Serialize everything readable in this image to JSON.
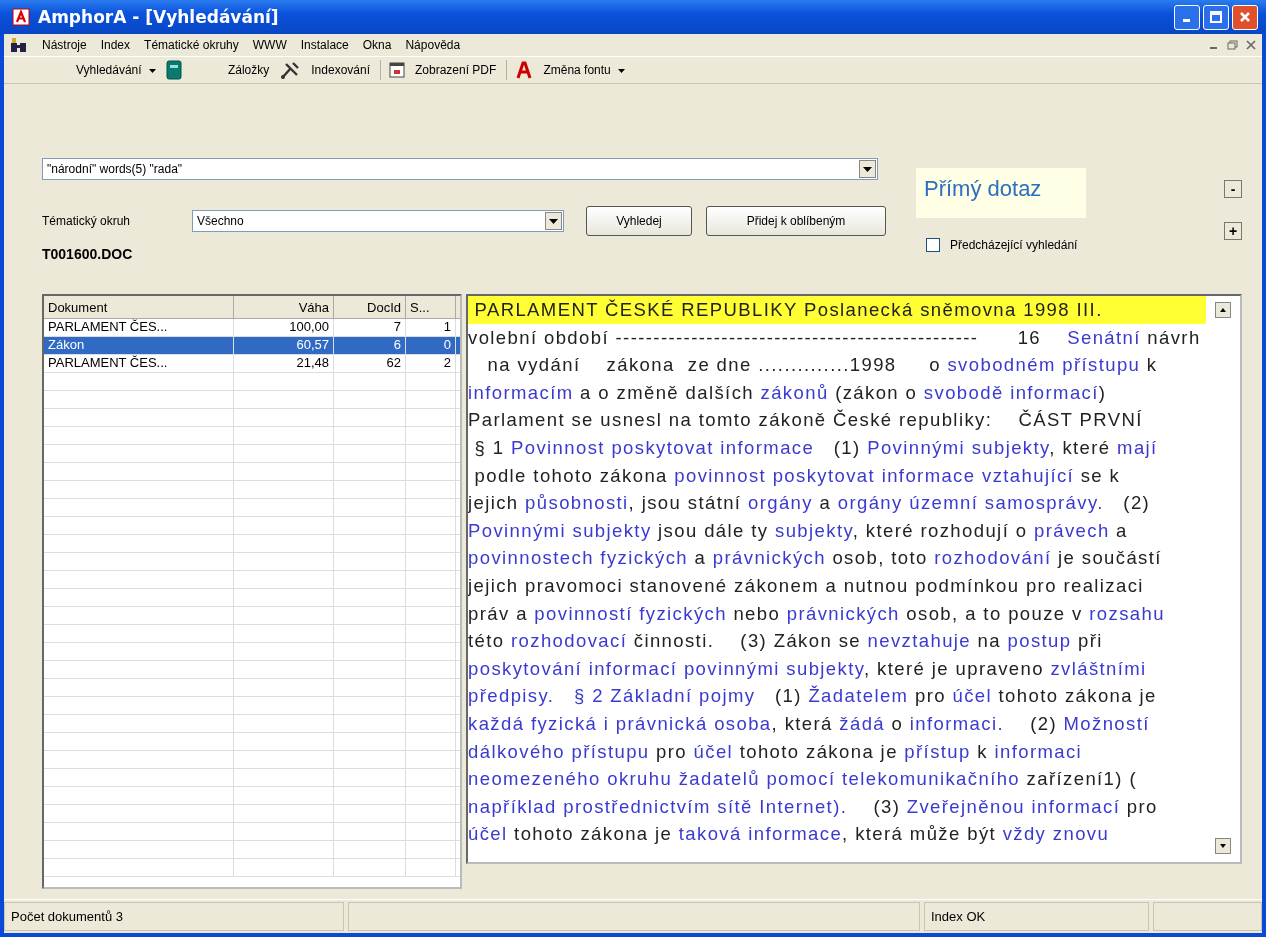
{
  "window": {
    "title": "AmphorA - [Vyhledávání]"
  },
  "menu": [
    "Nástroje",
    "Index",
    "Tématické okruhy",
    "WWW",
    "Instalace",
    "Okna",
    "Nápověda"
  ],
  "toolbar": [
    "Vyhledávání",
    "Záložky",
    "Indexování",
    "Zobrazení PDF",
    "Změna fontu"
  ],
  "query": {
    "value": "\"národní\" words(5) \"rada\""
  },
  "topic": {
    "label": "Tématický okruh",
    "value": "Všechno"
  },
  "buttons": [
    "Vyhledej",
    "Přidej k oblíbeným"
  ],
  "direct_query": "Přímý dotaz",
  "side_buttons": [
    "-",
    "+"
  ],
  "previous_search": {
    "label": "Předcházející vyhledání",
    "checked": false
  },
  "current_file": "T001600.DOC",
  "table": {
    "columns": [
      "Dokument",
      "Váha",
      "DocId",
      "S..."
    ],
    "rows": [
      {
        "cells": [
          "PARLAMENT ČES...",
          "100,00",
          "7",
          "1"
        ],
        "selected": false
      },
      {
        "cells": [
          "Zákon",
          "60,57",
          "6",
          "0"
        ],
        "selected": true
      },
      {
        "cells": [
          "PARLAMENT ČES...",
          "21,48",
          "62",
          "2"
        ],
        "selected": false
      }
    ]
  },
  "document": {
    "lines": [
      {
        "kind": "heading",
        "segments": [
          {
            "text": " PARLAMENT ČESKÉ REPUBLIKY Poslanecká sněmovna 1998 III.",
            "highlighted": false
          }
        ]
      },
      {
        "kind": "text",
        "segments": [
          {
            "text": "volební období ------------------------------------------------      16    ",
            "highlighted": false
          },
          {
            "text": "Senátní",
            "highlighted": true
          },
          {
            "text": " návrh",
            "highlighted": false
          }
        ]
      },
      {
        "kind": "text",
        "segments": [
          {
            "text": "   na vydání    zákona  ze dne ..............1998     o ",
            "highlighted": false
          },
          {
            "text": "svobodném přístupu",
            "highlighted": true
          },
          {
            "text": " k",
            "highlighted": false
          }
        ]
      },
      {
        "kind": "text",
        "segments": [
          {
            "text": "informacím",
            "highlighted": true
          },
          {
            "text": " a o změně dalších ",
            "highlighted": false
          },
          {
            "text": "zákonů",
            "highlighted": true
          },
          {
            "text": " (zákon o ",
            "highlighted": false
          },
          {
            "text": "svobodě informací",
            "highlighted": true
          },
          {
            "text": ")",
            "highlighted": false
          }
        ]
      },
      {
        "kind": "text",
        "segments": [
          {
            "text": "Parlament se usnesl na tomto zákoně České republiky:    ČÁST PRVNÍ",
            "highlighted": false
          }
        ]
      },
      {
        "kind": "text",
        "segments": [
          {
            "text": " § 1 ",
            "highlighted": false
          },
          {
            "text": "Povinnost poskytovat informace",
            "highlighted": true
          },
          {
            "text": "   (1) ",
            "highlighted": false
          },
          {
            "text": "Povinnými subjekty",
            "highlighted": true
          },
          {
            "text": ", které ",
            "highlighted": false
          },
          {
            "text": "mají",
            "highlighted": true
          }
        ]
      },
      {
        "kind": "text",
        "segments": [
          {
            "text": " podle tohoto zákona ",
            "highlighted": false
          },
          {
            "text": "povinnost poskytovat informace vztahující",
            "highlighted": true
          },
          {
            "text": " se k",
            "highlighted": false
          }
        ]
      },
      {
        "kind": "text",
        "segments": [
          {
            "text": "jejich ",
            "highlighted": false
          },
          {
            "text": "působnosti",
            "highlighted": true
          },
          {
            "text": ", jsou státní ",
            "highlighted": false
          },
          {
            "text": "orgány",
            "highlighted": true
          },
          {
            "text": " a ",
            "highlighted": false
          },
          {
            "text": "orgány územní samosprávy.",
            "highlighted": true
          },
          {
            "text": "   (2)",
            "highlighted": false
          }
        ]
      },
      {
        "kind": "text",
        "segments": [
          {
            "text": "Povinnými subjekty",
            "highlighted": true
          },
          {
            "text": " jsou dále ty ",
            "highlighted": false
          },
          {
            "text": "subjekty",
            "highlighted": true
          },
          {
            "text": ", které rozhodují o ",
            "highlighted": false
          },
          {
            "text": "právech",
            "highlighted": true
          },
          {
            "text": " a",
            "highlighted": false
          }
        ]
      },
      {
        "kind": "text",
        "segments": [
          {
            "text": "povinnostech fyzických",
            "highlighted": true
          },
          {
            "text": " a ",
            "highlighted": false
          },
          {
            "text": "právnických",
            "highlighted": true
          },
          {
            "text": " osob, toto ",
            "highlighted": false
          },
          {
            "text": "rozhodování",
            "highlighted": true
          },
          {
            "text": " je součástí",
            "highlighted": false
          }
        ]
      },
      {
        "kind": "text",
        "segments": [
          {
            "text": "jejich pravomoci stanovené zákonem a nutnou podmínkou pro realizaci",
            "highlighted": false
          }
        ]
      },
      {
        "kind": "text",
        "segments": [
          {
            "text": "práv a ",
            "highlighted": false
          },
          {
            "text": "povinností fyzických",
            "highlighted": true
          },
          {
            "text": " nebo ",
            "highlighted": false
          },
          {
            "text": "právnických",
            "highlighted": true
          },
          {
            "text": " osob, a to pouze v ",
            "highlighted": false
          },
          {
            "text": "rozsahu",
            "highlighted": true
          }
        ]
      },
      {
        "kind": "text",
        "segments": [
          {
            "text": "této ",
            "highlighted": false
          },
          {
            "text": "rozhodovací",
            "highlighted": true
          },
          {
            "text": " činnosti.    (3) Zákon se ",
            "highlighted": false
          },
          {
            "text": "nevztahuje",
            "highlighted": true
          },
          {
            "text": " na ",
            "highlighted": false
          },
          {
            "text": "postup",
            "highlighted": true
          },
          {
            "text": " při",
            "highlighted": false
          }
        ]
      },
      {
        "kind": "text",
        "segments": [
          {
            "text": "poskytování informací povinnými subjekty",
            "highlighted": true
          },
          {
            "text": ", které je upraveno ",
            "highlighted": false
          },
          {
            "text": "zvláštními",
            "highlighted": true
          }
        ]
      },
      {
        "kind": "text",
        "segments": [
          {
            "text": "předpisy.",
            "highlighted": true
          },
          {
            "text": "   § 2 Základní pojmy",
            "highlighted": true
          },
          {
            "text": "   (1) ",
            "highlighted": false
          },
          {
            "text": "Žadatelem",
            "highlighted": true
          },
          {
            "text": " pro ",
            "highlighted": false
          },
          {
            "text": "účel",
            "highlighted": true
          },
          {
            "text": " tohoto zákona je",
            "highlighted": false
          }
        ]
      },
      {
        "kind": "text",
        "segments": [
          {
            "text": "každá fyzická i právnická osoba",
            "highlighted": true
          },
          {
            "text": ", která ",
            "highlighted": false
          },
          {
            "text": "žádá",
            "highlighted": true
          },
          {
            "text": " o ",
            "highlighted": false
          },
          {
            "text": "informaci.",
            "highlighted": true
          },
          {
            "text": "    (2) ",
            "highlighted": false
          },
          {
            "text": "Možností",
            "highlighted": true
          }
        ]
      },
      {
        "kind": "text",
        "segments": [
          {
            "text": "dálkového přístupu",
            "highlighted": true
          },
          {
            "text": " pro ",
            "highlighted": false
          },
          {
            "text": "účel",
            "highlighted": true
          },
          {
            "text": " tohoto zákona je ",
            "highlighted": false
          },
          {
            "text": "přístup",
            "highlighted": true
          },
          {
            "text": " k ",
            "highlighted": false
          },
          {
            "text": "informaci",
            "highlighted": true
          }
        ]
      },
      {
        "kind": "text",
        "segments": [
          {
            "text": "neomezeného okruhu žadatelů pomocí telekomunikačního",
            "highlighted": true
          },
          {
            "text": " zařízení1) (",
            "highlighted": false
          }
        ]
      },
      {
        "kind": "text",
        "segments": [
          {
            "text": "například prostřednictvím sítě Internet).",
            "highlighted": true
          },
          {
            "text": "    (3) ",
            "highlighted": false
          },
          {
            "text": "Zveřejněnou informací",
            "highlighted": true
          },
          {
            "text": " pro",
            "highlighted": false
          }
        ]
      },
      {
        "kind": "text",
        "segments": [
          {
            "text": "účel",
            "highlighted": true
          },
          {
            "text": " tohoto zákona je ",
            "highlighted": false
          },
          {
            "text": "taková informace",
            "highlighted": true
          },
          {
            "text": ", která může být ",
            "highlighted": false
          },
          {
            "text": "vždy znovu",
            "highlighted": true
          }
        ]
      }
    ]
  },
  "status_bar": {
    "count": "Počet dokumentů  3",
    "index": "Index OK"
  }
}
